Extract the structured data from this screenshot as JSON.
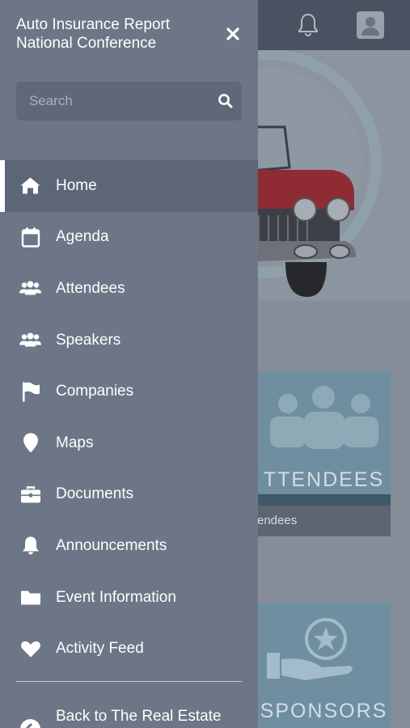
{
  "drawer": {
    "title_line1": "Auto Insurance Report",
    "title_line2": "National Conference",
    "close_icon": "close-icon",
    "search": {
      "placeholder": "Search",
      "value": "",
      "icon": "search-icon"
    },
    "menu": [
      {
        "label": "Home",
        "icon": "home-icon",
        "active": true
      },
      {
        "label": "Agenda",
        "icon": "calendar-icon",
        "active": false
      },
      {
        "label": "Attendees",
        "icon": "people-icon",
        "active": false
      },
      {
        "label": "Speakers",
        "icon": "people-icon",
        "active": false
      },
      {
        "label": "Companies",
        "icon": "flag-icon",
        "active": false
      },
      {
        "label": "Maps",
        "icon": "map-pin-icon",
        "active": false
      },
      {
        "label": "Documents",
        "icon": "briefcase-icon",
        "active": false
      },
      {
        "label": "Announcements",
        "icon": "bell-icon",
        "active": false
      },
      {
        "label": "Event Information",
        "icon": "folder-icon",
        "active": false
      },
      {
        "label": "Activity Feed",
        "icon": "heart-icon",
        "active": false
      }
    ],
    "back": {
      "label": "Back to The Real Estate",
      "icon": "back-arrow-icon"
    }
  },
  "background": {
    "topbar": {
      "bell_icon": "bell-icon",
      "profile_icon": "profile-icon"
    },
    "tiles": [
      {
        "label": "TTENDEES",
        "caption": "endees"
      },
      {
        "label": "SPONSORS"
      }
    ]
  },
  "colors": {
    "drawer_bg": "#6c7686",
    "drawer_active_bg": "#5d6677",
    "search_bg": "#5e6878",
    "topbar_bg": "#4a5261"
  }
}
